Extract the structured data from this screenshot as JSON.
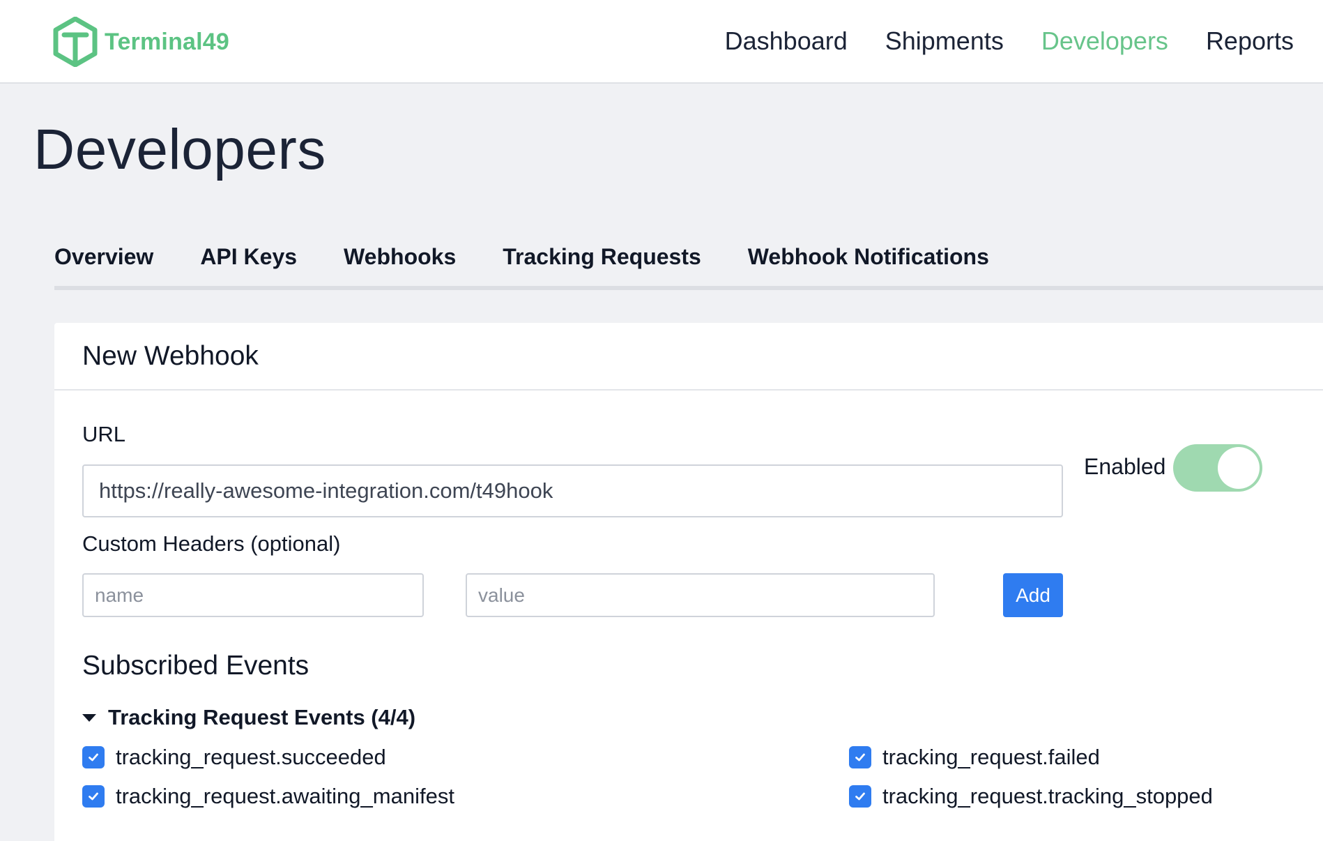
{
  "brand": {
    "name": "Terminal49",
    "color": "#5cc383"
  },
  "nav": {
    "items": [
      {
        "label": "Dashboard",
        "active": false
      },
      {
        "label": "Shipments",
        "active": false
      },
      {
        "label": "Developers",
        "active": true
      },
      {
        "label": "Reports",
        "active": false
      }
    ],
    "active_color": "#67c48a"
  },
  "page": {
    "title": "Developers"
  },
  "tabs": [
    {
      "label": "Overview"
    },
    {
      "label": "API Keys"
    },
    {
      "label": "Webhooks"
    },
    {
      "label": "Tracking Requests"
    },
    {
      "label": "Webhook Notifications"
    }
  ],
  "form": {
    "title": "New Webhook",
    "url_label": "URL",
    "url_value": "https://really-awesome-integration.com/t49hook",
    "enabled_label": "Enabled",
    "enabled": true,
    "headers_label": "Custom Headers (optional)",
    "header_name_placeholder": "name",
    "header_value_placeholder": "value",
    "add_label": "Add",
    "accent_color": "#2f7cf0",
    "toggle_color": "#9fd9b0"
  },
  "events": {
    "title": "Subscribed Events",
    "group": {
      "label": "Tracking Request Events (4/4)",
      "expanded": true,
      "items": [
        {
          "label": "tracking_request.succeeded",
          "checked": true
        },
        {
          "label": "tracking_request.failed",
          "checked": true
        },
        {
          "label": "tracking_request.awaiting_manifest",
          "checked": true
        },
        {
          "label": "tracking_request.tracking_stopped",
          "checked": true
        }
      ]
    }
  }
}
